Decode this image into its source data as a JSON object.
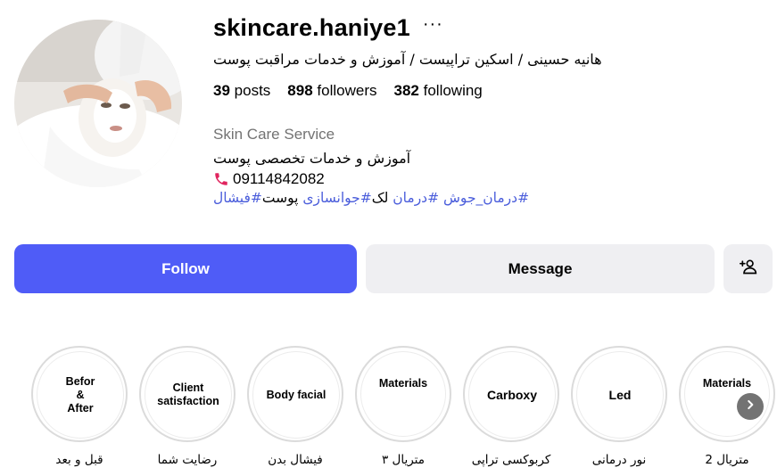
{
  "profile": {
    "username": "skincare.haniye1",
    "more_label": "···",
    "full_name": "هانیه حسینی / اسکین تراپیست / آموزش و خدمات مراقبت پوست",
    "stats": {
      "posts_count": "39",
      "posts_label": "posts",
      "followers_count": "898",
      "followers_label": "followers",
      "following_count": "382",
      "following_label": "following"
    },
    "category": "Skin Care Service",
    "bio_line": "آموزش و خدمات تخصصی پوست",
    "phone": "09114842082",
    "hashtags": {
      "t1": "#درمان_جوش",
      "t2": "#درمان",
      "w1": "لک",
      "t3": "#جوانسازی",
      "w2": "پوست",
      "t4": "#فیشال"
    }
  },
  "actions": {
    "follow_label": "Follow",
    "message_label": "Message",
    "add_user_icon": "add-user-icon"
  },
  "highlights": [
    {
      "title": "Befor & After",
      "label": "قبل و بعد"
    },
    {
      "title": "Client satisfaction",
      "label": "رضایت شما"
    },
    {
      "title": "Body facial",
      "label": "فیشال بدن"
    },
    {
      "title": "Materials",
      "label": "متریال ۳"
    },
    {
      "title": "Carboxy",
      "label": "کربوکسی تراپی"
    },
    {
      "title": "Led",
      "label": "نور درمانی"
    },
    {
      "title": "Materials",
      "label": "متریال 2"
    }
  ],
  "colors": {
    "follow_button": "#4f5cf7",
    "hashtag": "#4a5ddb",
    "category_text": "#737373",
    "phone_icon": "#e0245e"
  }
}
